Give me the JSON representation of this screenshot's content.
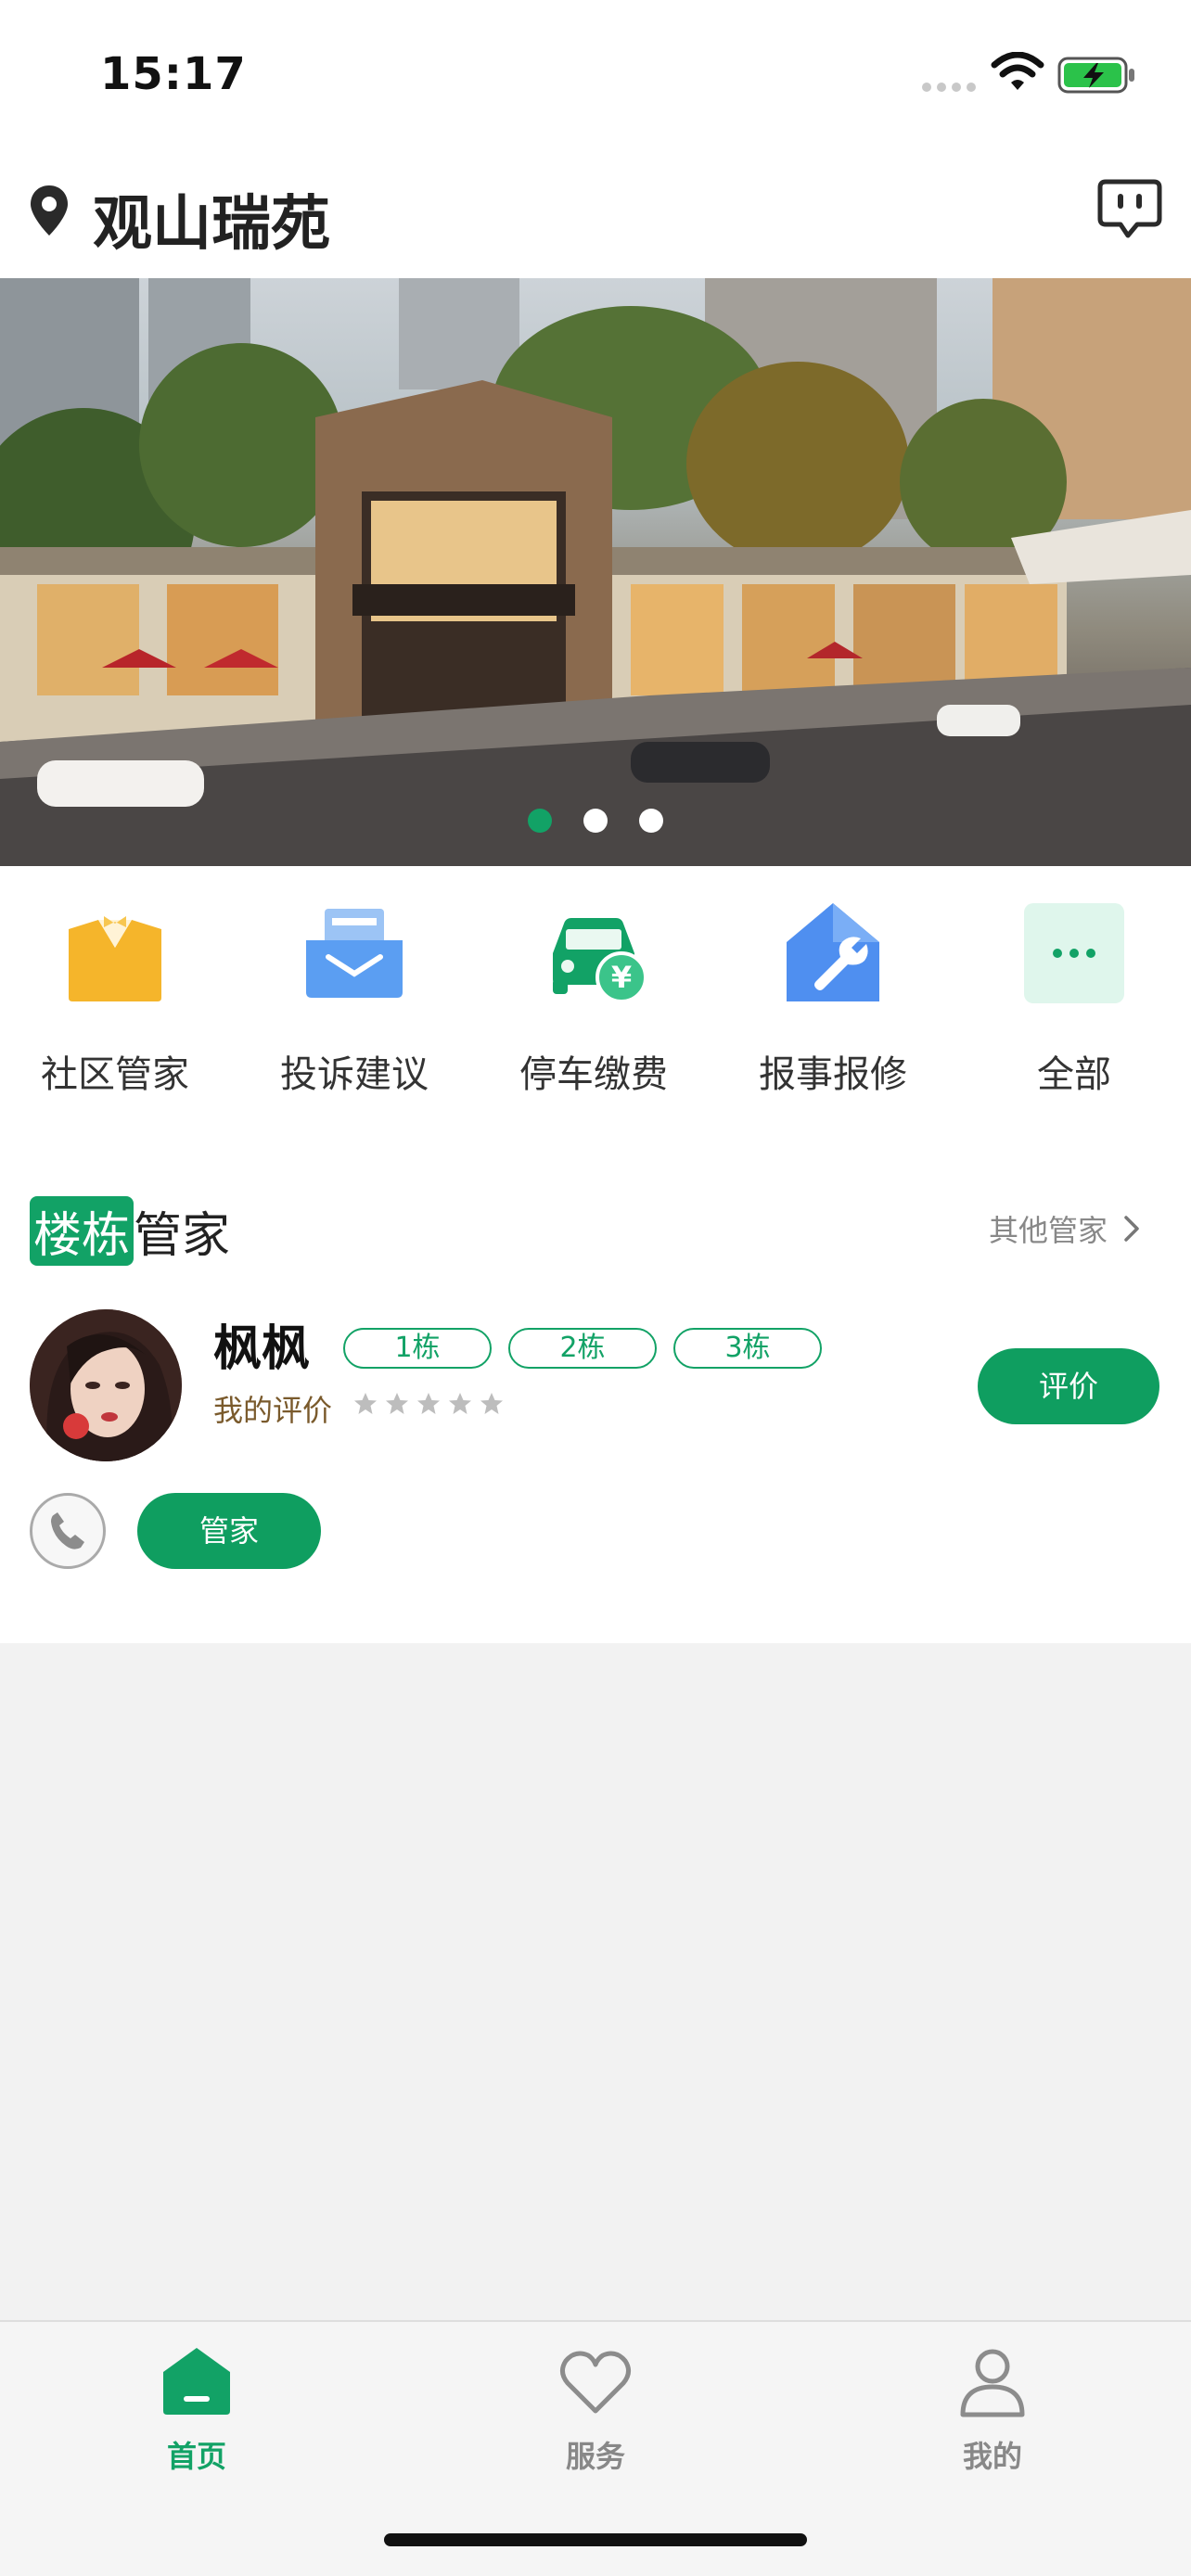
{
  "status_bar": {
    "time": "15:17"
  },
  "header": {
    "location_name": "观山瑞苑",
    "location_icon": "map-pin-icon",
    "message_icon": "chat-bubble-icon"
  },
  "banner": {
    "dots": [
      {
        "active": true
      },
      {
        "active": false
      },
      {
        "active": false
      }
    ]
  },
  "menu": {
    "items": [
      {
        "label": "社区管家",
        "icon": "butler-icon"
      },
      {
        "label": "投诉建议",
        "icon": "complaint-tray-icon"
      },
      {
        "label": "停车缴费",
        "icon": "parking-fee-icon"
      },
      {
        "label": "报事报修",
        "icon": "repair-wrench-icon"
      },
      {
        "label": "全部",
        "icon": "more-dots-icon"
      }
    ]
  },
  "steward_section": {
    "title_highlight": "楼栋",
    "title_rest": "管家",
    "other_link": "其他管家",
    "steward": {
      "name": "枫枫",
      "buildings": [
        "1栋",
        "2栋",
        "3栋"
      ],
      "rating_label": "我的评价",
      "rating": 0,
      "rating_max": 5,
      "rate_button": "评价",
      "role_button": "管家"
    }
  },
  "tabbar": {
    "tabs": [
      {
        "label": "首页",
        "active": true
      },
      {
        "label": "服务",
        "active": false
      },
      {
        "label": "我的",
        "active": false
      }
    ]
  },
  "colors": {
    "brand_green": "#12a266",
    "tag_border": "#12a266",
    "rating_label": "#7a5a2c"
  }
}
